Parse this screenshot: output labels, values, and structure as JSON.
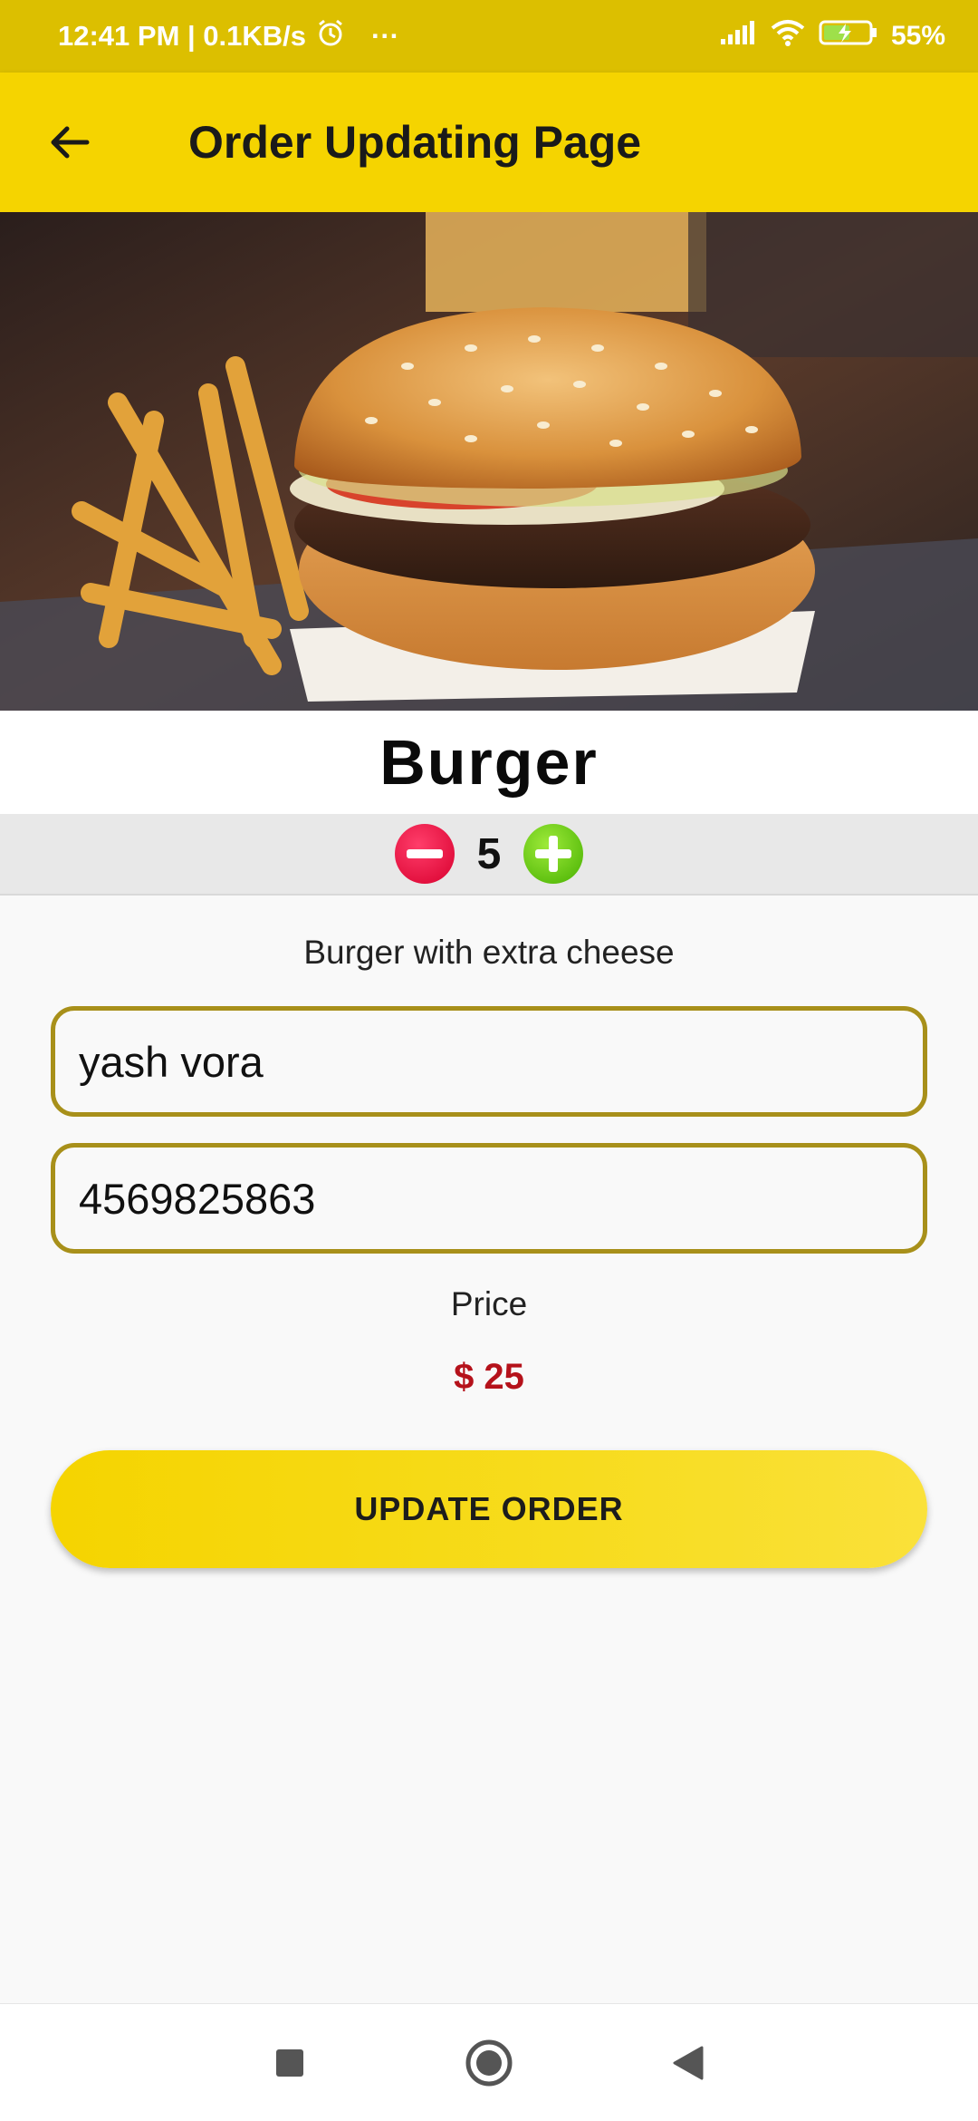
{
  "status_bar": {
    "time_speed": "12:41 PM | 0.1KB/s",
    "more": "···",
    "battery": "55%"
  },
  "app_bar": {
    "title": "Order Updating Page"
  },
  "product": {
    "name": "Burger",
    "quantity": "5",
    "description": "Burger with extra cheese"
  },
  "form": {
    "name_value": "yash vora",
    "phone_value": "4569825863"
  },
  "price": {
    "label": "Price",
    "value": "$ 25"
  },
  "actions": {
    "update_label": "UPDATE ORDER"
  },
  "colors": {
    "status_bar": "#dcbf00",
    "app_bar": "#f5d400",
    "field_border": "#a8901a",
    "price": "#b5121b",
    "minus": "#e8003a",
    "plus": "#62c80c"
  },
  "icons": [
    "alarm-icon",
    "signal-icon",
    "wifi-icon",
    "battery-icon",
    "back-arrow-icon",
    "minus-icon",
    "plus-icon",
    "square-icon",
    "circle-icon",
    "triangle-back-icon"
  ]
}
